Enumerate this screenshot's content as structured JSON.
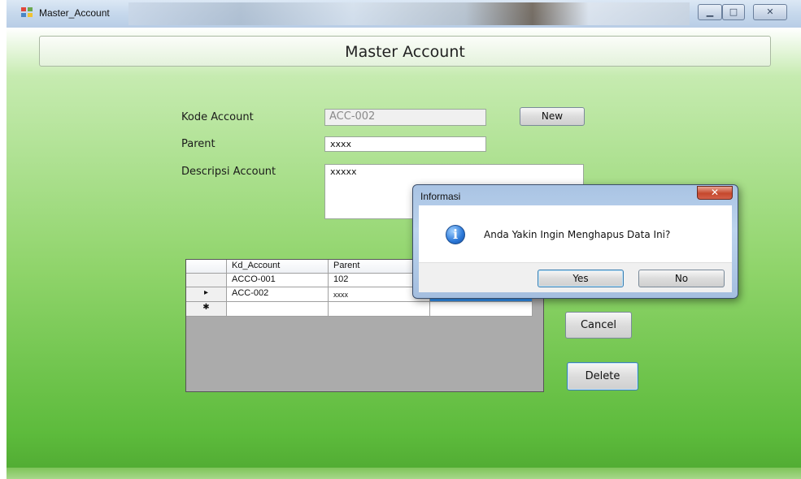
{
  "window": {
    "title": "Master_Account",
    "minimize_label": "▁",
    "maximize_label": "□",
    "close_label": "✕"
  },
  "header": {
    "title": "Master Account"
  },
  "form": {
    "kode_account_label": "Kode Account",
    "kode_account_value": "ACC-002",
    "parent_label": "Parent",
    "parent_value": "xxxx",
    "deskripsi_label": "Descripsi Account",
    "deskripsi_value": "xxxxx"
  },
  "buttons": {
    "new_label": "New",
    "cancel_label": "Cancel",
    "delete_label": "Delete"
  },
  "grid": {
    "columns": [
      "Kd_Account",
      "Parent",
      ""
    ],
    "rows": [
      {
        "indicator": "",
        "kd_account": "ACCO-001",
        "parent": "102"
      },
      {
        "indicator": "▸",
        "kd_account": "ACC-002",
        "parent": "xxxx"
      },
      {
        "indicator": "✱",
        "kd_account": "",
        "parent": ""
      }
    ]
  },
  "dialog": {
    "title": "Informasi",
    "close_label": "✕",
    "message": "Anda Yakin Ingin Menghapus Data Ini?",
    "yes_label": "Yes",
    "no_label": "No",
    "icon": "information-icon"
  },
  "colors": {
    "form_green": "#8fd46a",
    "titlebar_blue": "#c6d8ec",
    "dialog_frame": "#bcd4ee"
  }
}
